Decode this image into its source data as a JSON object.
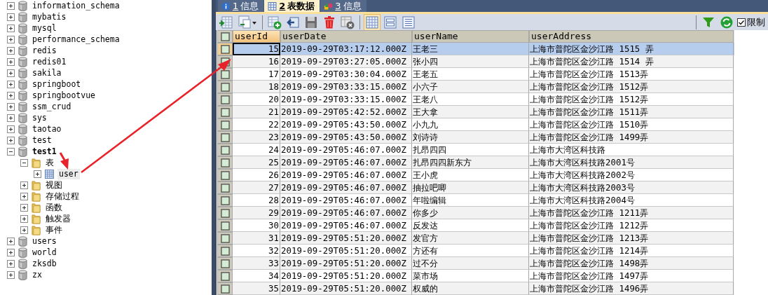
{
  "tree": [
    {
      "label": "information_schema",
      "kind": "database",
      "expanded": false,
      "selected": false,
      "active": false
    },
    {
      "label": "mybatis",
      "kind": "database",
      "expanded": false,
      "selected": false,
      "active": false
    },
    {
      "label": "mysql",
      "kind": "database",
      "expanded": false,
      "selected": false,
      "active": false
    },
    {
      "label": "performance_schema",
      "kind": "database",
      "expanded": false,
      "selected": false,
      "active": false
    },
    {
      "label": "redis",
      "kind": "database",
      "expanded": false,
      "selected": false,
      "active": false
    },
    {
      "label": "redis01",
      "kind": "database",
      "expanded": false,
      "selected": false,
      "active": false
    },
    {
      "label": "sakila",
      "kind": "database",
      "expanded": false,
      "selected": false,
      "active": false
    },
    {
      "label": "springboot",
      "kind": "database",
      "expanded": false,
      "selected": false,
      "active": false
    },
    {
      "label": "springbootvue",
      "kind": "database",
      "expanded": false,
      "selected": false,
      "active": false
    },
    {
      "label": "ssm_crud",
      "kind": "database",
      "expanded": false,
      "selected": false,
      "active": false
    },
    {
      "label": "sys",
      "kind": "database",
      "expanded": false,
      "selected": false,
      "active": false
    },
    {
      "label": "taotao",
      "kind": "database",
      "expanded": false,
      "selected": false,
      "active": false
    },
    {
      "label": "test",
      "kind": "database",
      "expanded": false,
      "selected": false,
      "active": false
    },
    {
      "label": "test1",
      "kind": "database",
      "expanded": true,
      "selected": false,
      "active": true,
      "children": [
        {
          "label": "表",
          "kind": "folder",
          "expanded": true,
          "selected": false,
          "active": false,
          "children": [
            {
              "label": "user",
              "kind": "table",
              "expanded": false,
              "selected": true,
              "active": false
            }
          ]
        },
        {
          "label": "视图",
          "kind": "folder",
          "expanded": false,
          "selected": false,
          "active": false
        },
        {
          "label": "存储过程",
          "kind": "folder",
          "expanded": false,
          "selected": false,
          "active": false
        },
        {
          "label": "函数",
          "kind": "folder",
          "expanded": false,
          "selected": false,
          "active": false
        },
        {
          "label": "触发器",
          "kind": "folder",
          "expanded": false,
          "selected": false,
          "active": false
        },
        {
          "label": "事件",
          "kind": "folder",
          "expanded": false,
          "selected": false,
          "active": false
        }
      ]
    },
    {
      "label": "users",
      "kind": "database",
      "expanded": false,
      "selected": false,
      "active": false
    },
    {
      "label": "world",
      "kind": "database",
      "expanded": false,
      "selected": false,
      "active": false
    },
    {
      "label": "zksdb",
      "kind": "database",
      "expanded": false,
      "selected": false,
      "active": false
    },
    {
      "label": "zx",
      "kind": "database",
      "expanded": false,
      "selected": false,
      "active": false
    }
  ],
  "tabs": [
    {
      "key": "1",
      "label": "信息",
      "kind": "info",
      "selected": false
    },
    {
      "key": "2",
      "label": "表数据",
      "kind": "table",
      "selected": true
    },
    {
      "key": "3",
      "label": "信息",
      "kind": "shapes",
      "selected": false
    }
  ],
  "toolbar": {
    "limit": {
      "label": "限制",
      "checked": true
    }
  },
  "table": {
    "select_all": {
      "checked": false
    },
    "columns": [
      {
        "label": "userId",
        "selected": true
      },
      {
        "label": "userDate",
        "selected": false
      },
      {
        "label": "userName",
        "selected": false
      },
      {
        "label": "userAddress",
        "selected": false
      }
    ],
    "rows": [
      {
        "cells": [
          "15",
          "2019-09-29T03:17:12.000Z",
          "王老三",
          "上海市普陀区金沙江路 1515 弄"
        ],
        "selected": true
      },
      {
        "cells": [
          "16",
          "2019-09-29T03:27:05.000Z",
          "张小四",
          "上海市普陀区金沙江路 1514 弄"
        ],
        "selected": false
      },
      {
        "cells": [
          "17",
          "2019-09-29T03:30:04.000Z",
          "王老五",
          "上海市普陀区金沙江路 1513弄"
        ],
        "selected": false
      },
      {
        "cells": [
          "18",
          "2019-09-29T03:33:15.000Z",
          "小六子",
          "上海市普陀区金沙江路 1512弄"
        ],
        "selected": false
      },
      {
        "cells": [
          "20",
          "2019-09-29T03:33:15.000Z",
          "王老八",
          "上海市普陀区金沙江路 1512弄"
        ],
        "selected": false
      },
      {
        "cells": [
          "21",
          "2019-09-29T05:42:52.000Z",
          "王大拿",
          "上海市普陀区金沙江路 1511弄"
        ],
        "selected": false
      },
      {
        "cells": [
          "22",
          "2019-09-29T05:43:50.000Z",
          "小九九",
          "上海市普陀区金沙江路 1510弄"
        ],
        "selected": false
      },
      {
        "cells": [
          "23",
          "2019-09-29T05:43:50.000Z",
          "刘诗诗",
          "上海市普陀区金沙江路 1499弄"
        ],
        "selected": false
      },
      {
        "cells": [
          "24",
          "2019-09-29T05:46:07.000Z",
          "扎昂四四",
          "上海市大湾区科技路"
        ],
        "selected": false
      },
      {
        "cells": [
          "25",
          "2019-09-29T05:46:07.000Z",
          "扎昂四四新东方",
          "上海市大湾区科技路2001号"
        ],
        "selected": false
      },
      {
        "cells": [
          "26",
          "2019-09-29T05:46:07.000Z",
          "王小虎",
          "上海市大湾区科技路2002号"
        ],
        "selected": false
      },
      {
        "cells": [
          "27",
          "2019-09-29T05:46:07.000Z",
          "抽拉吧唧",
          "上海市大湾区科技路2003号"
        ],
        "selected": false
      },
      {
        "cells": [
          "28",
          "2019-09-29T05:46:07.000Z",
          "年啦编辑",
          "上海市大湾区科技路2004号"
        ],
        "selected": false
      },
      {
        "cells": [
          "29",
          "2019-09-29T05:46:07.000Z",
          "你多少",
          "上海市普陀区金沙江路 1211弄"
        ],
        "selected": false
      },
      {
        "cells": [
          "30",
          "2019-09-29T05:46:07.000Z",
          "反发达",
          "上海市普陀区金沙江路 1212弄"
        ],
        "selected": false
      },
      {
        "cells": [
          "31",
          "2019-09-29T05:51:20.000Z",
          "发官方",
          "上海市普陀区金沙江路 1213弄"
        ],
        "selected": false
      },
      {
        "cells": [
          "32",
          "2019-09-29T05:51:20.000Z",
          "方还有",
          "上海市普陀区金沙江路 1214弄"
        ],
        "selected": false
      },
      {
        "cells": [
          "33",
          "2019-09-29T05:51:20.000Z",
          "过不分",
          "上海市普陀区金沙江路 1498弄"
        ],
        "selected": false
      },
      {
        "cells": [
          "34",
          "2019-09-29T05:51:20.000Z",
          "菜市场",
          "上海市普陀区金沙江路 1497弄"
        ],
        "selected": false
      },
      {
        "cells": [
          "35",
          "2019-09-29T05:51:20.000Z",
          "权威的",
          "上海市普陀区金沙江路 1496弄"
        ],
        "selected": false
      }
    ]
  }
}
